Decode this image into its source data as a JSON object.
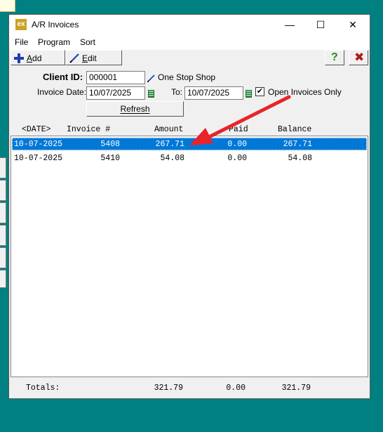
{
  "window": {
    "title": "A/R Invoices",
    "icon_text": "ex"
  },
  "title_controls": {
    "minimize": "—",
    "maximize": "☐",
    "close": "✕"
  },
  "menu": [
    "File",
    "Program",
    "Sort"
  ],
  "toolbar": {
    "add_label": "Add",
    "edit_label": "Edit",
    "add_accel": "A",
    "edit_accel": "E"
  },
  "form": {
    "client_id_label": "Client ID:",
    "client_id_value": "000001",
    "client_name": "One Stop Shop",
    "invoice_date_label": "Invoice Date:",
    "from_date": "10/07/2025",
    "to_label": "To:",
    "to_date": "10/07/2025",
    "open_only_label": "Open Invoices Only",
    "open_only_checked": true,
    "refresh_label": "Refresh"
  },
  "table": {
    "headers": [
      "<DATE>",
      "Invoice #",
      "Amount",
      "Paid",
      "Balance"
    ],
    "rows": [
      {
        "date": "10-07-2025",
        "invoice": "5408",
        "amount": "267.71",
        "paid": "0.00",
        "balance": "267.71",
        "selected": true
      },
      {
        "date": "10-07-2025",
        "invoice": "5410",
        "amount": "54.08",
        "paid": "0.00",
        "balance": "54.08",
        "selected": false
      }
    ]
  },
  "totals": {
    "label": "Totals:",
    "amount": "321.79",
    "paid": "0.00",
    "balance": "321.79"
  },
  "colors": {
    "selection": "#0078d7",
    "annotation_arrow": "#e8232a",
    "desktop": "#008080"
  }
}
